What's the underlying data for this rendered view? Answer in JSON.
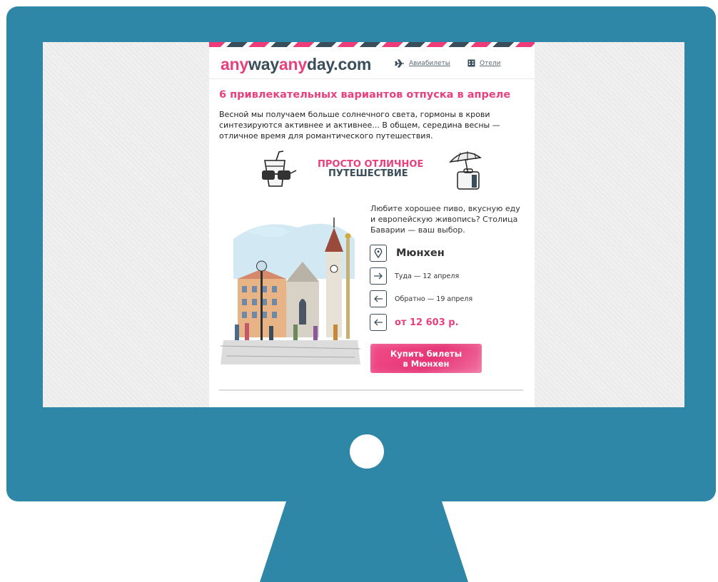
{
  "email": {
    "logo": {
      "part1": "any",
      "part2": "way",
      "part3": "any",
      "part4": "day",
      "part5": ".com"
    },
    "nav": {
      "flights_label": "Авиабилеты",
      "hotels_label": "Отели"
    },
    "title": "6 привлекательных вариантов отпуска в апреле",
    "intro": "Весной мы получаем больше солнечного света, гормоны в крови синтезируются активнее и активнее... В общем, середина весны — отличное время для романтического путешествия.",
    "promo": {
      "line1": "ПРОСТО ОТЛИЧНОЕ",
      "line2": "ПУТЕШЕСТВИЕ"
    },
    "offer": {
      "description": "Любите хорошее пиво, вкусную еду и европейскую живопись? Столица Баварии — ваш выбор.",
      "city": "Мюнхен",
      "departure": "Туда — 12 апреля",
      "return": "Обратно — 19 апреля",
      "price": "от 12 603 р.",
      "button_line1": "Купить билеты",
      "button_line2": "в Мюнхен"
    }
  },
  "colors": {
    "brand_pink": "#e8407c",
    "brand_dark": "#3a4d5b",
    "monitor": "#2f87a8"
  }
}
